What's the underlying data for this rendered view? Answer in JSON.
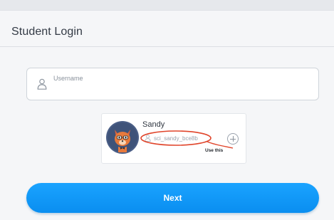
{
  "page": {
    "title": "Student Login"
  },
  "username": {
    "placeholder": "Username"
  },
  "student_card": {
    "name": "Sandy",
    "id": "sci_sandy_bce8b",
    "annotation": "Use this"
  },
  "actions": {
    "next_label": "Next"
  },
  "icons": {
    "field_icon": "user-outline-icon",
    "id_icon": "user-outline-icon",
    "avatar": "fox-avatar-icon",
    "add": "plus-circle-icon"
  },
  "colors": {
    "accent": "#0a8ef0",
    "highlight": "#e0442a"
  }
}
